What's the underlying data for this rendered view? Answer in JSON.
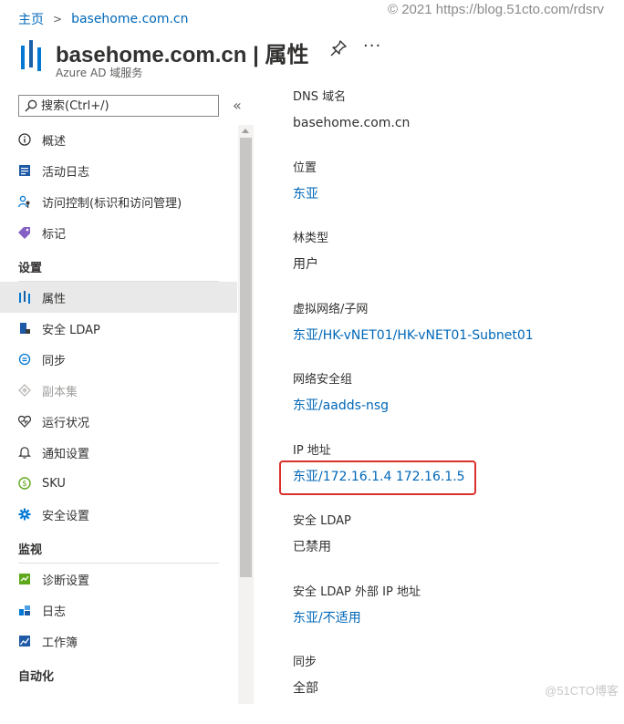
{
  "watermark": "© 2021 https://blog.51cto.com/rdsrv",
  "corner_watermark": "@51CTO博客",
  "breadcrumb": {
    "home": "主页",
    "separator": ">",
    "current": "basehome.com.cn"
  },
  "header": {
    "title": "basehome.com.cn | 属性",
    "subtitle": "Azure AD 域服务",
    "more": "···"
  },
  "search": {
    "placeholder": "搜索(Ctrl+/)",
    "collapse_glyph": "«"
  },
  "nav": {
    "items_top": [
      {
        "label": "概述",
        "icon": "info-icon"
      },
      {
        "label": "活动日志",
        "icon": "activity-log-icon"
      },
      {
        "label": "访问控制(标识和访问管理)",
        "icon": "people-icon"
      },
      {
        "label": "标记",
        "icon": "tag-icon"
      }
    ],
    "section_settings": "设置",
    "items_settings": [
      {
        "label": "属性",
        "icon": "properties-icon",
        "active": true
      },
      {
        "label": "安全 LDAP",
        "icon": "secure-ldap-icon"
      },
      {
        "label": "同步",
        "icon": "sync-icon"
      },
      {
        "label": "副本集",
        "icon": "replica-set-icon",
        "disabled": true
      },
      {
        "label": "运行状况",
        "icon": "health-icon"
      },
      {
        "label": "通知设置",
        "icon": "bell-icon"
      },
      {
        "label": "SKU",
        "icon": "sku-icon"
      },
      {
        "label": "安全设置",
        "icon": "gear-icon"
      }
    ],
    "section_monitor": "监视",
    "items_monitor": [
      {
        "label": "诊断设置",
        "icon": "diagnostics-icon"
      },
      {
        "label": "日志",
        "icon": "logs-icon"
      },
      {
        "label": "工作簿",
        "icon": "workbook-icon"
      }
    ],
    "section_automation": "自动化"
  },
  "properties": [
    {
      "label": "DNS 域名",
      "value": "basehome.com.cn",
      "link": false
    },
    {
      "label": "位置",
      "value": "东亚",
      "link": true
    },
    {
      "label": "林类型",
      "value": "用户",
      "link": false
    },
    {
      "label": "虚拟网络/子网",
      "value": "东亚/HK-vNET01/HK-vNET01-Subnet01",
      "link": true
    },
    {
      "label": "网络安全组",
      "value": "东亚/aadds-nsg",
      "link": true
    },
    {
      "label": "IP 地址",
      "value": "东亚/172.16.1.4 172.16.1.5",
      "link": true,
      "highlighted": true
    },
    {
      "label": "安全 LDAP",
      "value": "已禁用",
      "link": false
    },
    {
      "label": "安全 LDAP 外部 IP 地址",
      "value": "东亚/不适用",
      "link": true
    },
    {
      "label": "同步",
      "value": "全部",
      "link": false
    }
  ],
  "colors": {
    "link": "#0067b8",
    "highlight_border": "#d9302b",
    "active_bg": "#e9e9e9"
  }
}
